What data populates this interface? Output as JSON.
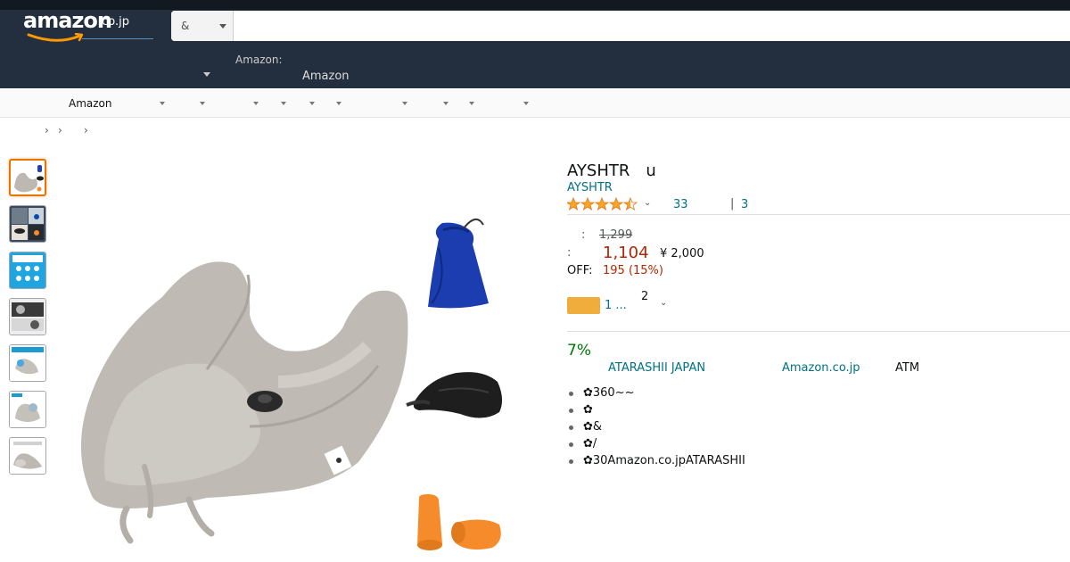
{
  "header": {
    "logo_text": "amazon",
    "logo_tld": ".co.jp",
    "search": {
      "category": "&",
      "placeholder": "",
      "value": ""
    },
    "deliver_line1": "Amazon:",
    "deliver_line2": "Amazon"
  },
  "subnav": {
    "label": "Amazon"
  },
  "product": {
    "title": "AYSHTR　u",
    "brand": "AYSHTR",
    "rating": {
      "stars": 4.5,
      "count": "33",
      "separator": "|",
      "answered_questions": "3"
    },
    "list_price_label": ":",
    "list_price": "1,299",
    "price_label": ":",
    "price": "1,104",
    "reference_price": "¥ 2,000",
    "off_label": "OFF:",
    "off_value": "195 (15%)",
    "offer_link": "1 ...",
    "offer_count": "2",
    "points": "7%",
    "seller": "ATARASHII JAPAN",
    "shipper": "Amazon.co.jp",
    "payment": "ATM",
    "bullets": [
      "✿360~~",
      "✿",
      "✿&",
      "✿/",
      "✿30Amazon.co.jpATARASHII"
    ]
  },
  "colors": {
    "nav_dark": "#131921",
    "nav": "#232f3e",
    "link": "#007185",
    "price": "#b12704",
    "points": "#007600",
    "star": "#ffa41c",
    "thumb_active": "#e77600"
  }
}
